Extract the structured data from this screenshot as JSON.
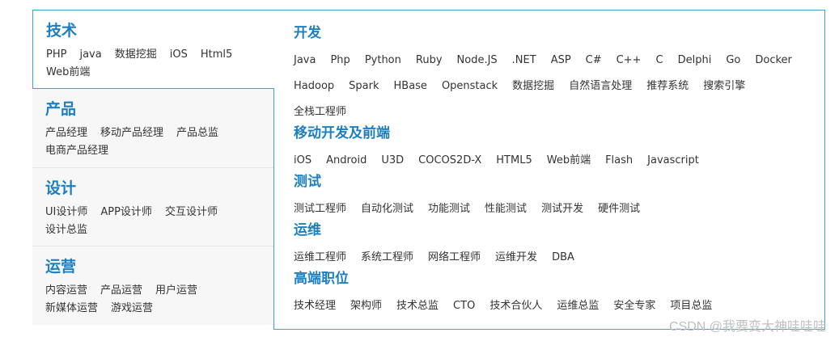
{
  "left_categories": [
    {
      "title": "技术",
      "links": [
        "PHP",
        "java",
        "数据挖掘",
        "iOS",
        "Html5",
        "Web前端"
      ]
    },
    {
      "title": "产品",
      "links": [
        "产品经理",
        "移动产品经理",
        "产品总监",
        "电商产品经理"
      ]
    },
    {
      "title": "设计",
      "links": [
        "UI设计师",
        "APP设计师",
        "交互设计师",
        "设计总监"
      ]
    },
    {
      "title": "运营",
      "links": [
        "内容运营",
        "产品运营",
        "用户运营",
        "新媒体运营",
        "游戏运营"
      ]
    }
  ],
  "panel_sections": [
    {
      "title": "开发",
      "links": [
        "Java",
        "Php",
        "Python",
        "Ruby",
        "Node.JS",
        ".NET",
        "ASP",
        "C#",
        "C++",
        "C",
        "Delphi",
        "Go",
        "Docker",
        "Hadoop",
        "Spark",
        "HBase",
        "Openstack",
        "数据挖掘",
        "自然语言处理",
        "推荐系统",
        "搜索引擎",
        "全栈工程师"
      ]
    },
    {
      "title": "移动开发及前端",
      "links": [
        "iOS",
        "Android",
        "U3D",
        "COCOS2D-X",
        "HTML5",
        "Web前端",
        "Flash",
        "Javascript"
      ]
    },
    {
      "title": "测试",
      "links": [
        "测试工程师",
        "自动化测试",
        "功能测试",
        "性能测试",
        "测试开发",
        "硬件测试"
      ]
    },
    {
      "title": "运维",
      "links": [
        "运维工程师",
        "系统工程师",
        "网络工程师",
        "运维开发",
        "DBA"
      ]
    },
    {
      "title": "高端职位",
      "links": [
        "技术经理",
        "架构师",
        "技术总监",
        "CTO",
        "技术合伙人",
        "运维总监",
        "安全专家",
        "项目总监"
      ]
    }
  ],
  "watermark": "CSDN @我要变大神哇哇哇",
  "colors": {
    "accent": "#1d7fbf",
    "border": "#3fa3c7",
    "left_bg": "#f7f7f7"
  }
}
